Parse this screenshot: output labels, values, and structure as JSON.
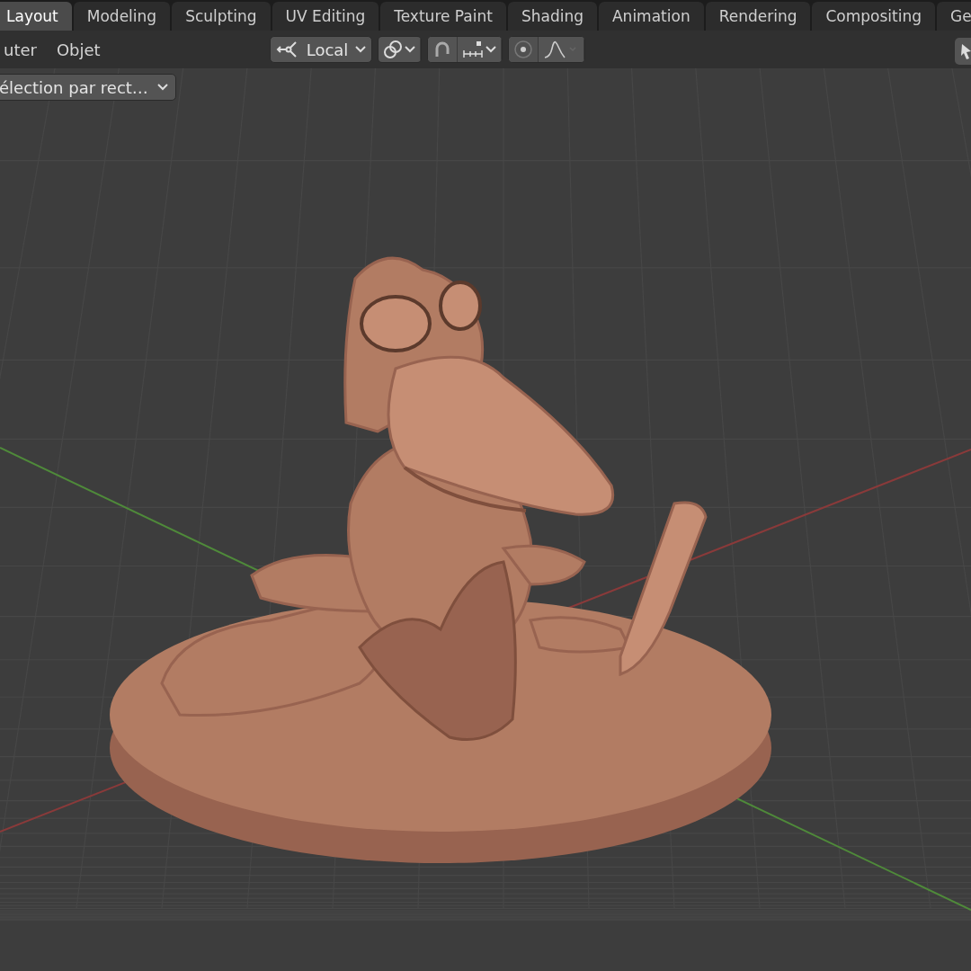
{
  "workspace_tabs": [
    {
      "label": "Layout",
      "selected": true
    },
    {
      "label": "Modeling",
      "selected": false
    },
    {
      "label": "Sculpting",
      "selected": false
    },
    {
      "label": "UV Editing",
      "selected": false
    },
    {
      "label": "Texture Paint",
      "selected": false
    },
    {
      "label": "Shading",
      "selected": false
    },
    {
      "label": "Animation",
      "selected": false
    },
    {
      "label": "Rendering",
      "selected": false
    },
    {
      "label": "Compositing",
      "selected": false
    },
    {
      "label": "Ge",
      "selected": false
    }
  ],
  "header": {
    "menus": [
      "uter",
      "Objet"
    ],
    "pivot": {
      "label": "Local"
    }
  },
  "viewport": {
    "select_mode": {
      "label": "élection par rect…"
    }
  }
}
